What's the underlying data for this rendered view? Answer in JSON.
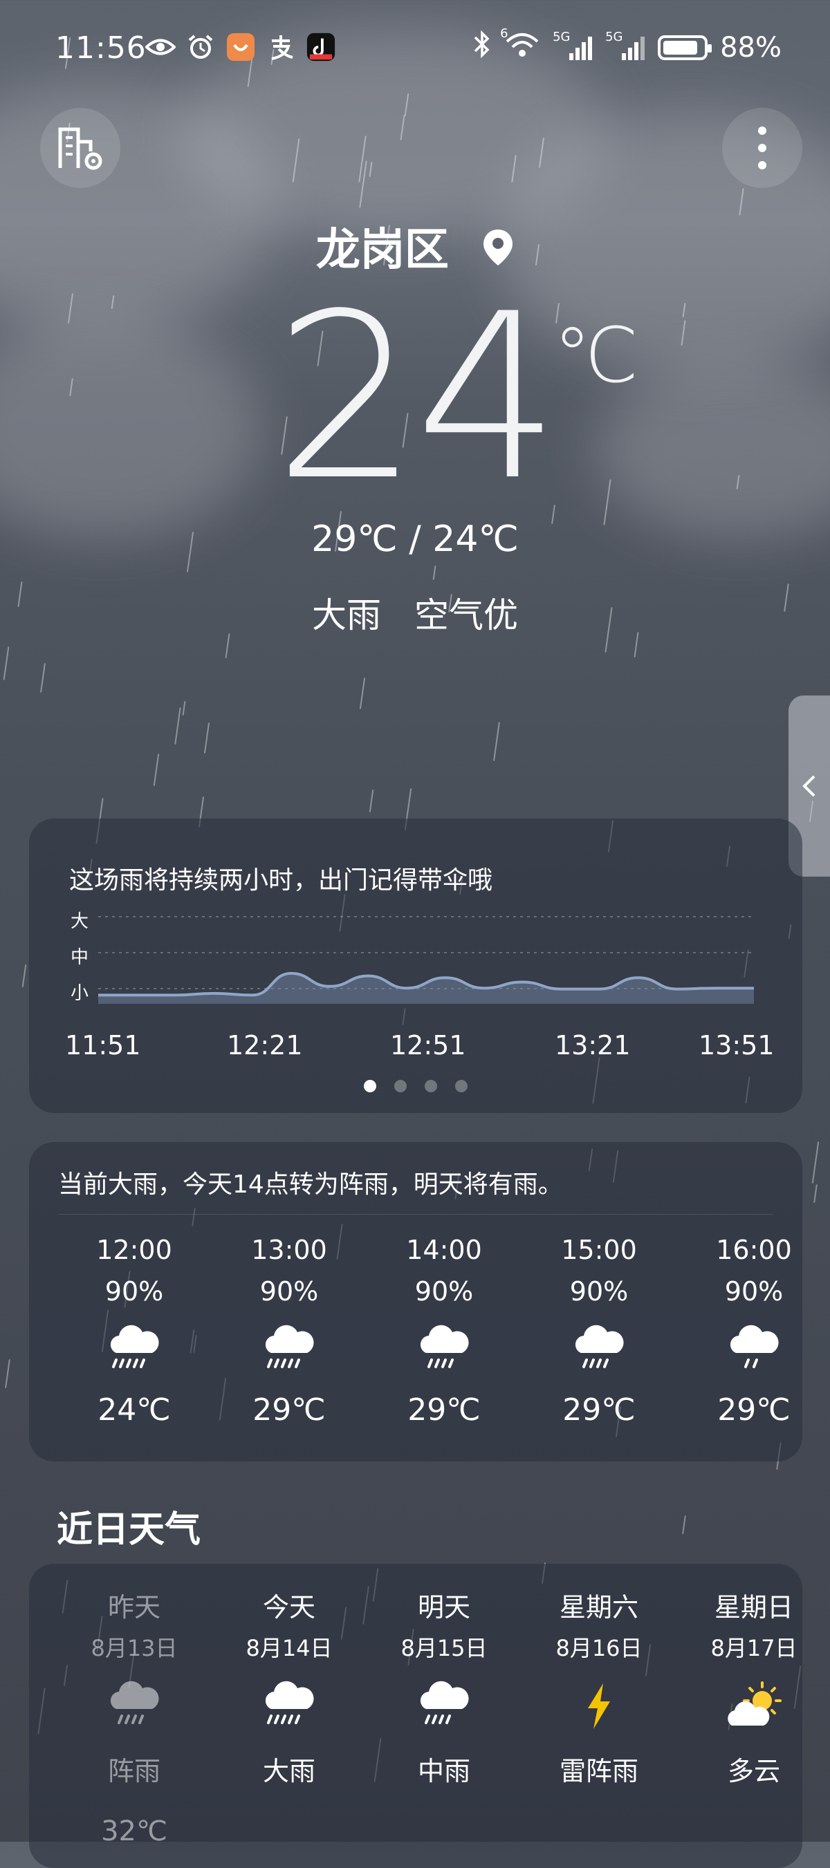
{
  "status_bar": {
    "time": "11:56",
    "battery": "88%",
    "battery_level": 0.88,
    "signal_1": "5G",
    "signal_2": "5G",
    "wifi_tag": "6"
  },
  "header": {
    "city": "龙岗区",
    "manage_cities_icon": "city-settings-icon",
    "more_icon": "more-vertical-icon"
  },
  "current": {
    "temp": "24",
    "unit": "℃",
    "range": "29℃ / 24℃",
    "condition": "大雨",
    "air_quality": "空气优"
  },
  "rain_forecast": {
    "message": "这场雨将持续两小时，出门记得带伞哦",
    "levels": [
      "大",
      "中",
      "小"
    ],
    "times": [
      "11:51",
      "12:21",
      "12:51",
      "13:21",
      "13:51"
    ],
    "intensity": [
      0.1,
      0.1,
      0.1,
      0.12,
      0.1,
      0.35,
      0.2,
      0.32,
      0.18,
      0.3,
      0.18,
      0.25,
      0.17,
      0.17,
      0.3,
      0.17,
      0.18,
      0.18
    ],
    "page_count": 4,
    "active_page": 0
  },
  "hourly": {
    "summary": "当前大雨，今天14点转为阵雨，明天将有雨。",
    "items": [
      {
        "time": "12:00",
        "precip": "90%",
        "icon": "heavy-rain-icon",
        "temp": "24℃"
      },
      {
        "time": "13:00",
        "precip": "90%",
        "icon": "heavy-rain-icon",
        "temp": "29℃"
      },
      {
        "time": "14:00",
        "precip": "90%",
        "icon": "shower-icon",
        "temp": "29℃"
      },
      {
        "time": "15:00",
        "precip": "90%",
        "icon": "shower-icon",
        "temp": "29℃"
      },
      {
        "time": "16:00",
        "precip": "90%",
        "icon": "light-rain-icon",
        "temp": "29℃"
      }
    ]
  },
  "daily": {
    "title": "近日天气",
    "items": [
      {
        "name": "昨天",
        "date": "8月13日",
        "icon": "shower-icon",
        "cond": "阵雨",
        "high": "32℃"
      },
      {
        "name": "今天",
        "date": "8月14日",
        "icon": "heavy-rain-icon",
        "cond": "大雨"
      },
      {
        "name": "明天",
        "date": "8月15日",
        "icon": "moderate-rain-icon",
        "cond": "中雨"
      },
      {
        "name": "星期六",
        "date": "8月16日",
        "icon": "thunder-icon",
        "cond": "雷阵雨"
      },
      {
        "name": "星期日",
        "date": "8月17日",
        "icon": "partly-cloudy-icon",
        "cond": "多云"
      }
    ]
  },
  "colors": {
    "thunder": "#f5c400",
    "sun": "#ffcc33",
    "chart_line": "#8fa6c8"
  }
}
